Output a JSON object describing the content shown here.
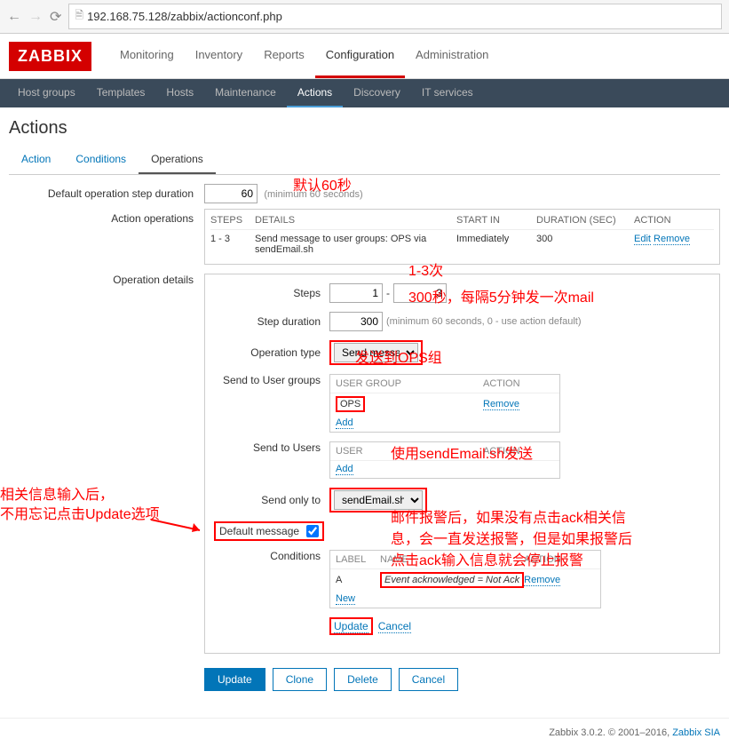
{
  "browser": {
    "url": "192.168.75.128/zabbix/actionconf.php"
  },
  "logo": "ZABBIX",
  "mainNav": [
    "Monitoring",
    "Inventory",
    "Reports",
    "Configuration",
    "Administration"
  ],
  "mainNavActive": "Configuration",
  "subNav": [
    "Host groups",
    "Templates",
    "Hosts",
    "Maintenance",
    "Actions",
    "Discovery",
    "IT services"
  ],
  "subNavActive": "Actions",
  "pageTitle": "Actions",
  "tabs": [
    "Action",
    "Conditions",
    "Operations"
  ],
  "tabActive": "Operations",
  "form": {
    "defaultStepDurationLabel": "Default operation step duration",
    "defaultStepDurationValue": "60",
    "defaultStepDurationHint": "(minimum 60 seconds)",
    "actionOperationsLabel": "Action operations",
    "opsHeaders": {
      "steps": "STEPS",
      "details": "DETAILS",
      "start": "START IN",
      "duration": "DURATION (SEC)",
      "action": "ACTION"
    },
    "opsRow": {
      "steps": "1 - 3",
      "details": "Send message to user groups: OPS via sendEmail.sh",
      "start": "Immediately",
      "duration": "300",
      "edit": "Edit",
      "remove": "Remove"
    },
    "operationDetailsLabel": "Operation details",
    "stepsLabel": "Steps",
    "stepsFrom": "1",
    "stepsTo": "3",
    "stepDurationLabel": "Step duration",
    "stepDurationValue": "300",
    "stepDurationHint": "(minimum 60 seconds, 0 - use action default)",
    "operationTypeLabel": "Operation type",
    "operationTypeValue": "Send message",
    "sendToUserGroupsLabel": "Send to User groups",
    "userGroupHeader": "USER GROUP",
    "userGroupActionHeader": "ACTION",
    "userGroupValue": "OPS",
    "userGroupRemove": "Remove",
    "userGroupAdd": "Add",
    "sendToUsersLabel": "Send to Users",
    "userHeader": "USER",
    "userActionHeader": "ACTION",
    "userAdd": "Add",
    "sendOnlyToLabel": "Send only to",
    "sendOnlyToValue": "sendEmail.sh",
    "defaultMessageLabel": "Default message",
    "conditionsLabel": "Conditions",
    "condLabelHeader": "LABEL",
    "condNameHeader": "NAME",
    "condActionHeader": "ACTION",
    "condLabel": "A",
    "condName": "Event acknowledged = Not Ack",
    "condRemove": "Remove",
    "condNew": "New",
    "innerUpdate": "Update",
    "innerCancel": "Cancel"
  },
  "buttons": {
    "update": "Update",
    "clone": "Clone",
    "delete": "Delete",
    "cancel": "Cancel"
  },
  "annotations": {
    "a1": "默认60秒",
    "a2": "1-3次",
    "a3": "300秒，每隔5分钟发一次mail",
    "a4": "发送到OPS组",
    "a5": "使用sendEmail.sh发送",
    "a6_line1": "相关信息输入后，",
    "a6_line2": "不用忘记点击Update选项",
    "a7_line1": "邮件报警后，如果没有点击ack相关信",
    "a7_line2": "息，会一直发送报警，但是如果报警后",
    "a7_line3": "点击ack输入信息就会停止报警"
  },
  "footer": {
    "text": "Zabbix 3.0.2. © 2001–2016, ",
    "link": "Zabbix SIA"
  }
}
